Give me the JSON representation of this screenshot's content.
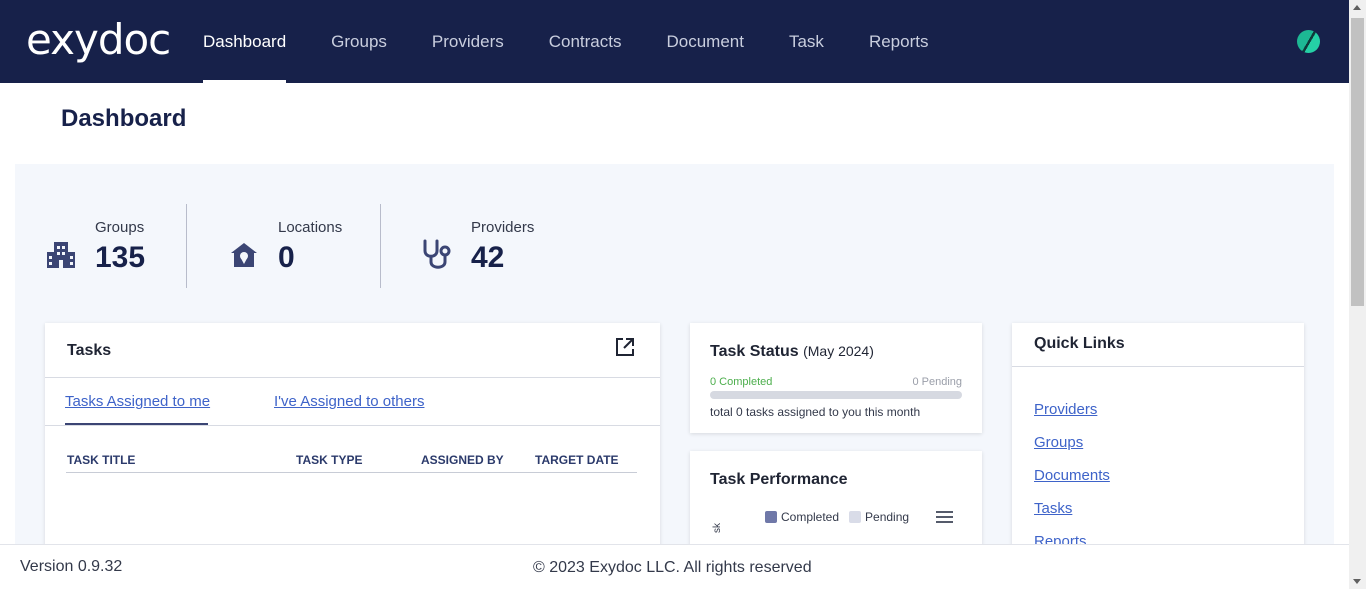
{
  "brand": {
    "logo_text": "exydoc",
    "accent": "#17214a",
    "avatar_color": "#1db894"
  },
  "nav": {
    "items": [
      {
        "label": "Dashboard",
        "active": true
      },
      {
        "label": "Groups",
        "active": false
      },
      {
        "label": "Providers",
        "active": false
      },
      {
        "label": "Contracts",
        "active": false
      },
      {
        "label": "Document",
        "active": false
      },
      {
        "label": "Task",
        "active": false
      },
      {
        "label": "Reports",
        "active": false
      }
    ]
  },
  "page": {
    "title": "Dashboard"
  },
  "stats": [
    {
      "label": "Groups",
      "value": "135",
      "icon": "building-icon"
    },
    {
      "label": "Locations",
      "value": "0",
      "icon": "location-home-icon"
    },
    {
      "label": "Providers",
      "value": "42",
      "icon": "stethoscope-icon"
    }
  ],
  "tasks": {
    "title": "Tasks",
    "tabs": [
      "Tasks Assigned to me",
      "I've Assigned to others"
    ],
    "columns": [
      "TASK TITLE",
      "TASK TYPE",
      "ASSIGNED BY",
      "TARGET DATE"
    ]
  },
  "task_status": {
    "title": "Task Status",
    "period": "(May 2024)",
    "completed_label": "0 Completed",
    "pending_label": "0 Pending",
    "completed_fraction": 0,
    "note": "total 0 tasks assigned to you this month"
  },
  "task_performance": {
    "title": "Task Performance",
    "legend": [
      {
        "name": "Completed",
        "color": "#6f78a8"
      },
      {
        "name": "Pending",
        "color": "#d9dce8"
      }
    ],
    "axis_fragment": "sk"
  },
  "quick_links": {
    "title": "Quick Links",
    "items": [
      "Providers",
      "Groups",
      "Documents",
      "Tasks",
      "Reports"
    ]
  },
  "footer": {
    "version": "Version 0.9.32",
    "copyright": "© 2023 Exydoc LLC. All rights reserved"
  }
}
